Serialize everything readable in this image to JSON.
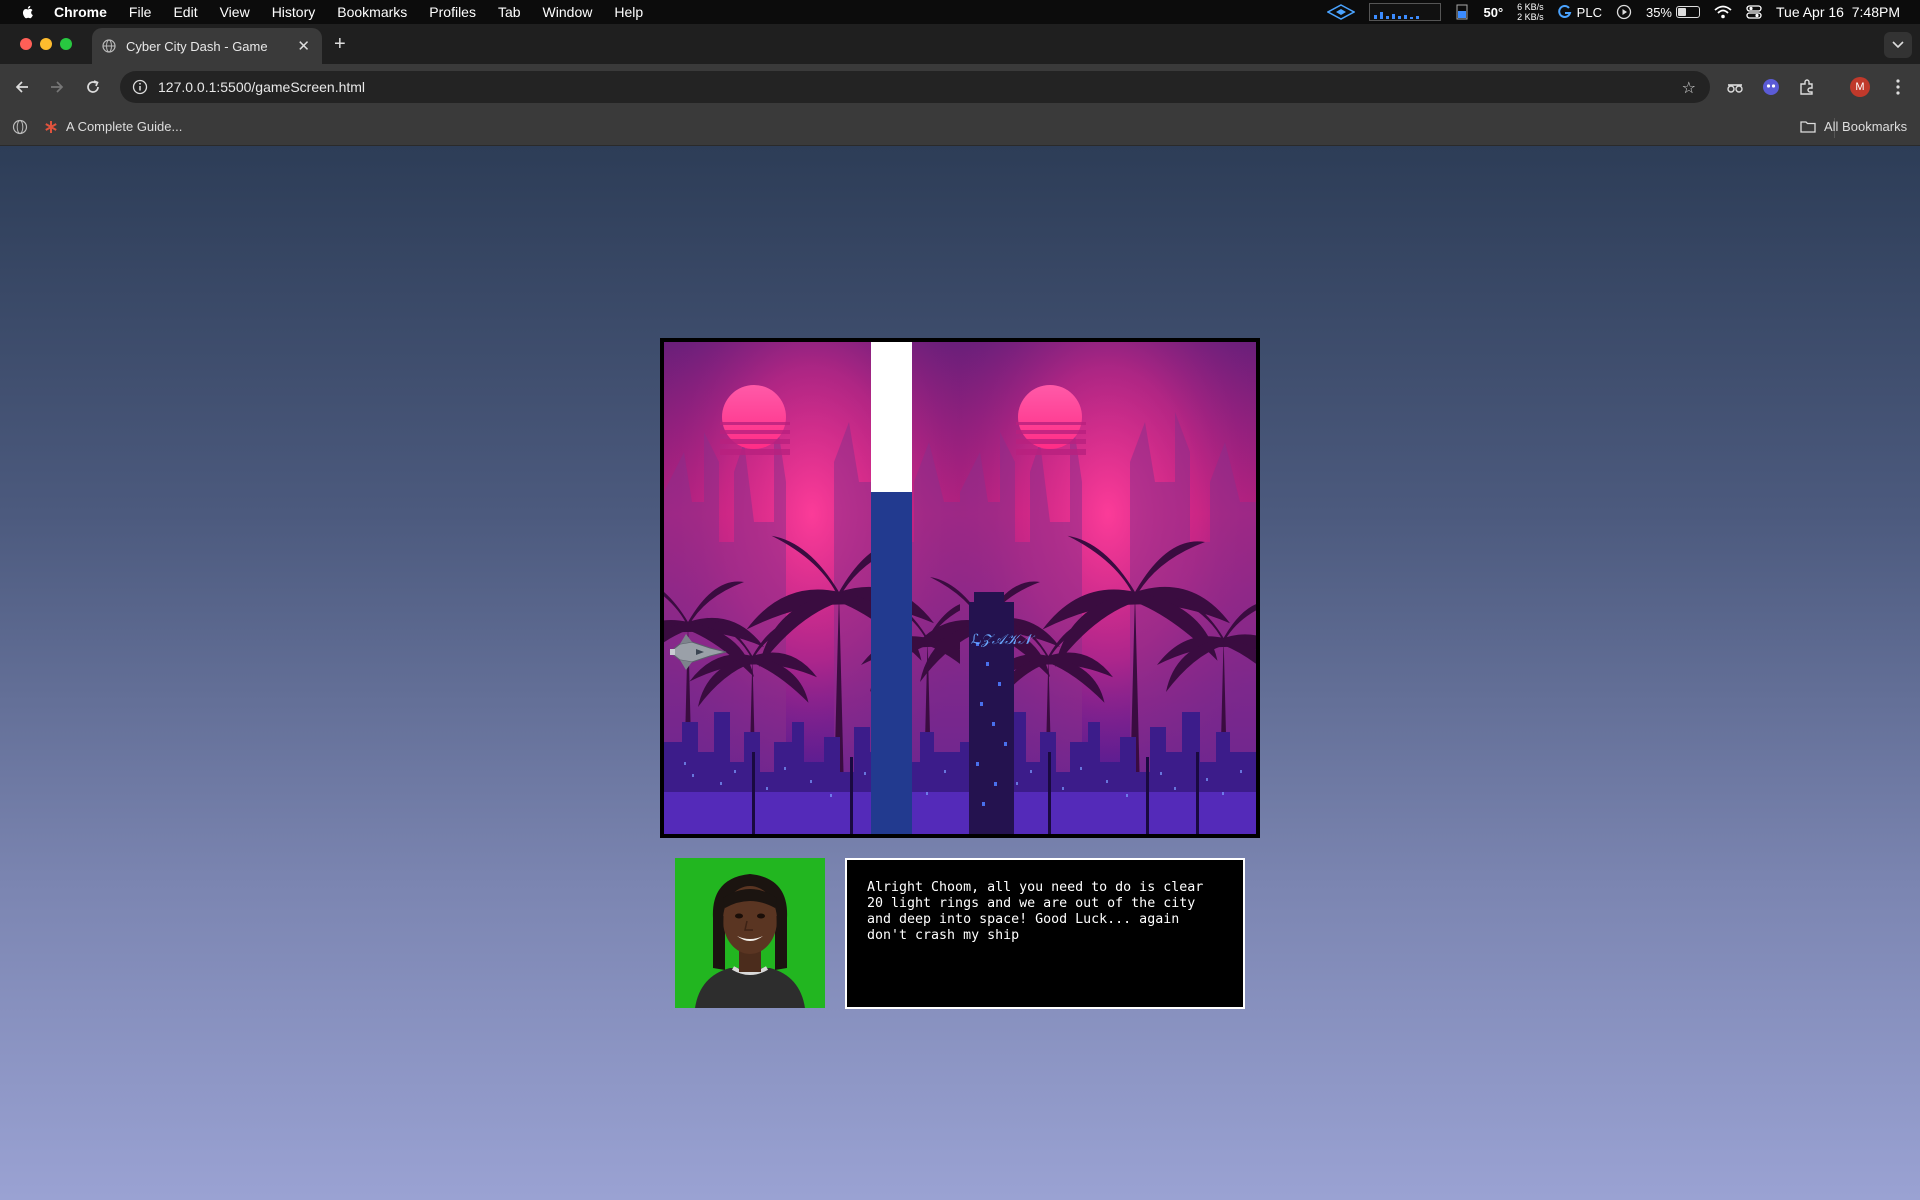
{
  "menubar": {
    "app_name": "Chrome",
    "items": [
      "File",
      "Edit",
      "View",
      "History",
      "Bookmarks",
      "Profiles",
      "Tab",
      "Window",
      "Help"
    ],
    "status": {
      "temperature": "50°",
      "net_up": "6 KB/s",
      "net_down": "2 KB/s",
      "vpn_label": "PLC",
      "battery": "35%",
      "clock": "Tue Apr 16  7:48PM"
    }
  },
  "tab": {
    "title": "Cyber City Dash - Game"
  },
  "toolbar": {
    "url": "127.0.0.1:5500/gameScreen.html",
    "profile_initial": "M"
  },
  "bookmarks": {
    "item": "A Complete Guide...",
    "all_bookmarks": "All Bookmarks"
  },
  "dialog": {
    "text": "Alright Choom, all you need to do is clear 20 light rings and we are out of the city and deep into space! Good Luck... again don't crash my ship"
  },
  "colors": {
    "traffic_red": "#ff5f57",
    "traffic_yellow": "#febc2e",
    "traffic_green": "#28c840",
    "obstacle_top": "#ffffff",
    "obstacle_bottom": "#223a8f",
    "portrait_bg": "#22b620"
  }
}
